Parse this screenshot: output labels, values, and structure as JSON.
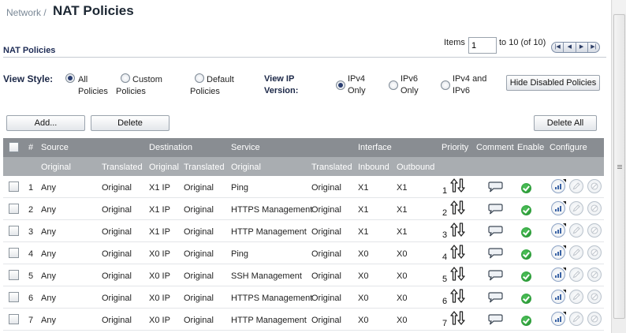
{
  "breadcrumb": "Network /",
  "page_title": "NAT Policies",
  "section_title": "NAT Policies",
  "pager": {
    "items_label": "Items",
    "items_value": "1",
    "range_text": "to 10 (of 10)"
  },
  "view_style": {
    "label": "View Style:",
    "options": [
      {
        "label": "All\nPolicies",
        "selected": true
      },
      {
        "label": "Custom\nPolicies",
        "selected": false
      },
      {
        "label": "Default\nPolicies",
        "selected": false
      }
    ]
  },
  "ip_version": {
    "label": "View IP\nVersion:",
    "options": [
      {
        "label": "IPv4\nOnly",
        "selected": true
      },
      {
        "label": "IPv6\nOnly",
        "selected": false
      },
      {
        "label": "IPv4 and\nIPv6",
        "selected": false
      }
    ]
  },
  "buttons": {
    "hide_disabled": "Hide Disabled Policies",
    "add": "Add...",
    "delete": "Delete",
    "delete_all": "Delete All"
  },
  "table": {
    "header_top": {
      "num": "#",
      "source": "Source",
      "destination": "Destination",
      "service": "Service",
      "interface": "Interface",
      "priority": "Priority",
      "comment": "Comment",
      "enable": "Enable",
      "configure": "Configure"
    },
    "header_sub": {
      "src_original": "Original",
      "src_translated": "Translated",
      "dst_original": "Original",
      "dst_translated": "Translated",
      "svc_original": "Original",
      "svc_translated": "Translated",
      "inbound": "Inbound",
      "outbound": "Outbound"
    },
    "rows": [
      {
        "num": "1",
        "src_orig": "Any",
        "src_trans": "Original",
        "dst_orig": "X1 IP",
        "dst_trans": "Original",
        "svc_orig": "Ping",
        "svc_trans": "Original",
        "inbound": "X1",
        "outbound": "X1",
        "priority": "1"
      },
      {
        "num": "2",
        "src_orig": "Any",
        "src_trans": "Original",
        "dst_orig": "X1 IP",
        "dst_trans": "Original",
        "svc_orig": "HTTPS Management",
        "svc_trans": "Original",
        "inbound": "X1",
        "outbound": "X1",
        "priority": "2"
      },
      {
        "num": "3",
        "src_orig": "Any",
        "src_trans": "Original",
        "dst_orig": "X1 IP",
        "dst_trans": "Original",
        "svc_orig": "HTTP Management",
        "svc_trans": "Original",
        "inbound": "X1",
        "outbound": "X1",
        "priority": "3"
      },
      {
        "num": "4",
        "src_orig": "Any",
        "src_trans": "Original",
        "dst_orig": "X0 IP",
        "dst_trans": "Original",
        "svc_orig": "Ping",
        "svc_trans": "Original",
        "inbound": "X0",
        "outbound": "X0",
        "priority": "4"
      },
      {
        "num": "5",
        "src_orig": "Any",
        "src_trans": "Original",
        "dst_orig": "X0 IP",
        "dst_trans": "Original",
        "svc_orig": "SSH Management",
        "svc_trans": "Original",
        "inbound": "X0",
        "outbound": "X0",
        "priority": "5"
      },
      {
        "num": "6",
        "src_orig": "Any",
        "src_trans": "Original",
        "dst_orig": "X0 IP",
        "dst_trans": "Original",
        "svc_orig": "HTTPS Management",
        "svc_trans": "Original",
        "inbound": "X0",
        "outbound": "X0",
        "priority": "6"
      },
      {
        "num": "7",
        "src_orig": "Any",
        "src_trans": "Original",
        "dst_orig": "X0 IP",
        "dst_trans": "Original",
        "svc_orig": "HTTP Management",
        "svc_trans": "Original",
        "inbound": "X0",
        "outbound": "X0",
        "priority": "7"
      }
    ]
  },
  "icons": {
    "priority": "up-down-arrows-icon",
    "comment": "speech-bubble-icon",
    "enable": "green-check-icon",
    "statistics": "statistics-icon",
    "edit": "pencil-icon",
    "delete": "no-entry-icon"
  },
  "colors": {
    "header_top": "#898d92",
    "header_sub": "#a9adb1",
    "title": "#1c2733",
    "enable_green": "#1d8a2a"
  }
}
